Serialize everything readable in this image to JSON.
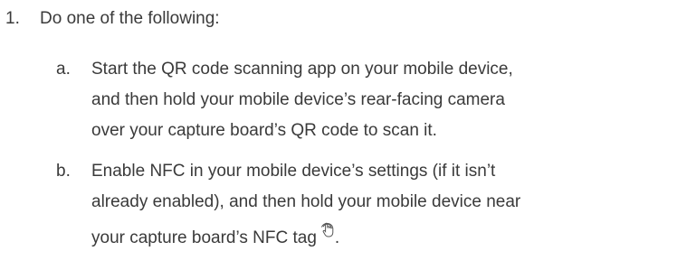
{
  "steps": [
    {
      "number": "1.",
      "text": "Do one of the following:",
      "substeps": [
        {
          "letter": "a.",
          "lines": [
            "Start the QR code scanning app on your mobile device,",
            "and then hold your mobile device’s rear-facing camera",
            "over your capture board’s QR code to scan it."
          ]
        },
        {
          "letter": "b.",
          "lines": [
            "Enable NFC in your mobile device’s settings (if it isn’t",
            "already enabled), and then hold your mobile device near",
            "your capture board’s NFC tag"
          ],
          "trailing_icon": "nfc-tap-icon",
          "trailing_text": "."
        }
      ]
    }
  ]
}
